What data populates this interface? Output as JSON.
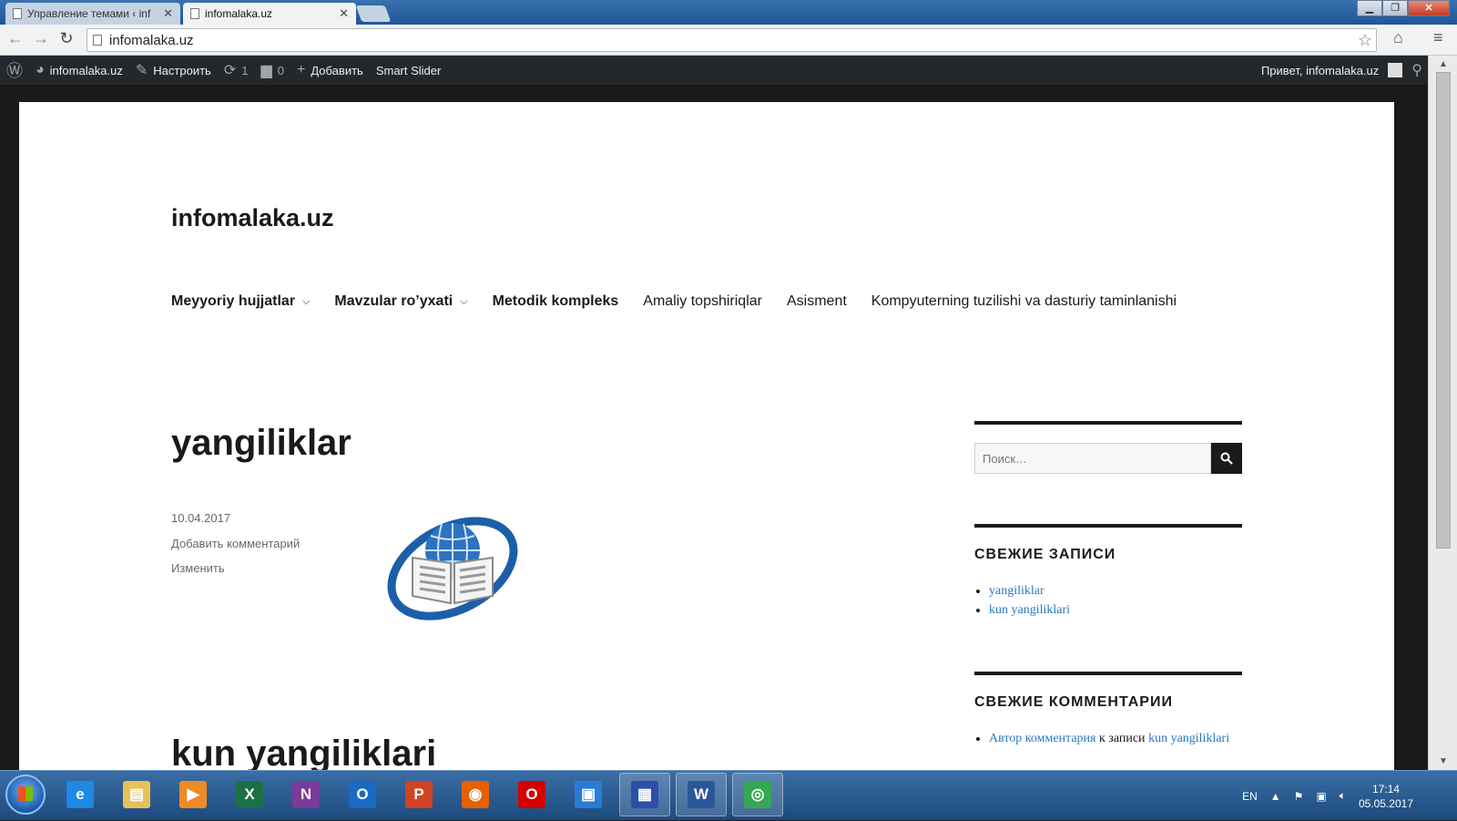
{
  "browser": {
    "tabs": [
      {
        "title": "Управление темами ‹ inf"
      },
      {
        "title": "infomalaka.uz"
      }
    ],
    "address": "infomalaka.uz"
  },
  "adminbar": {
    "site_name": "infomalaka.uz",
    "customize": "Настроить",
    "updates_count": "1",
    "comments_count": "0",
    "add_new": "Добавить",
    "smart_slider": "Smart Slider",
    "greeting": "Привет, infomalaka.uz"
  },
  "site": {
    "title": "infomalaka.uz",
    "nav": [
      {
        "label": "Meyyoriy hujjatlar"
      },
      {
        "label": "Mavzular ro’yxati"
      },
      {
        "label": "Metodik kompleks"
      },
      {
        "label": "Amaliy topshiriqlar"
      },
      {
        "label": "Asisment"
      },
      {
        "label": "Kompyuterning tuzilishi va dasturiy taminlanishi"
      }
    ]
  },
  "post": {
    "title": "yangiliklar",
    "date": "10.04.2017",
    "add_comment": "Добавить комментарий",
    "edit": "Изменить",
    "next_title": "kun yangiliklari"
  },
  "sidebar": {
    "search_placeholder": "Поиск…",
    "recent_posts_title": "СВЕЖИЕ ЗАПИСИ",
    "recent_posts": [
      {
        "label": "yangiliklar"
      },
      {
        "label": "kun yangiliklari"
      }
    ],
    "recent_comments_title": "СВЕЖИЕ КОММЕНТАРИИ",
    "recent_comment": {
      "author": "Автор комментария",
      "middle": " к записи ",
      "post": "kun yangiliklari"
    }
  },
  "taskbar": {
    "apps": [
      {
        "name": "internet-explorer-icon",
        "glyph": "e",
        "color": "#1e88e5"
      },
      {
        "name": "explorer-icon",
        "glyph": "▤",
        "color": "#e8c05a"
      },
      {
        "name": "media-player-icon",
        "glyph": "▶",
        "color": "#f08a24"
      },
      {
        "name": "excel-icon",
        "glyph": "X",
        "color": "#1d7044"
      },
      {
        "name": "onenote-icon",
        "glyph": "N",
        "color": "#7a3b9a"
      },
      {
        "name": "outlook-icon",
        "glyph": "O",
        "color": "#1a6ac2"
      },
      {
        "name": "powerpoint-icon",
        "glyph": "P",
        "color": "#d04423"
      },
      {
        "name": "firefox-icon",
        "glyph": "◉",
        "color": "#e66000"
      },
      {
        "name": "opera-icon",
        "glyph": "O",
        "color": "#d40000"
      },
      {
        "name": "presentation-icon",
        "glyph": "▣",
        "color": "#2a7bd4"
      },
      {
        "name": "save-disk-icon",
        "glyph": "▦",
        "color": "#2c4fa8"
      },
      {
        "name": "word-icon",
        "glyph": "W",
        "color": "#2b579a"
      },
      {
        "name": "chrome-icon",
        "glyph": "◎",
        "color": "#34a853"
      }
    ],
    "language": "EN",
    "time": "17:14",
    "date": "05.05.2017"
  }
}
